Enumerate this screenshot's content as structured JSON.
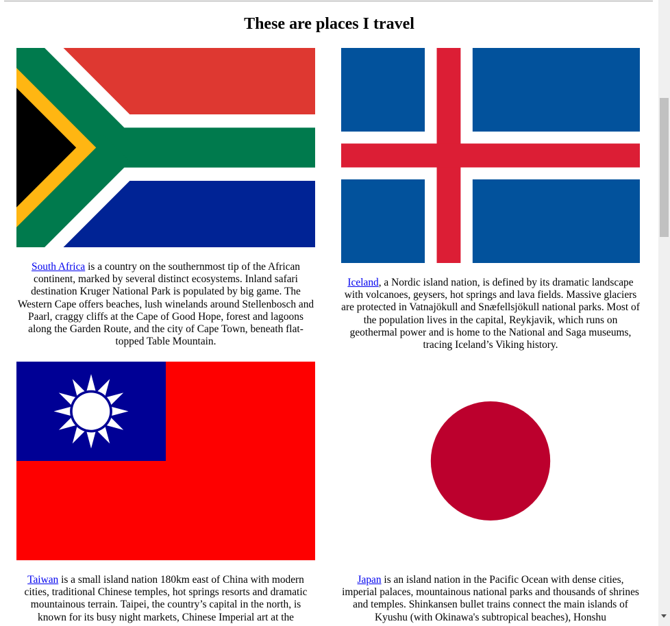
{
  "page": {
    "title": "These are places I travel"
  },
  "places": [
    {
      "link": "South Africa",
      "text": " is a country on the southernmost tip of the African continent, marked by several distinct ecosystems. Inland safari destination Kruger National Park is populated by big game. The Western Cape offers beaches, lush winelands around Stellenbosch and Paarl, craggy cliffs at the Cape of Good Hope, forest and lagoons along the Garden Route, and the city of Cape Town, beneath flat-topped Table Mountain."
    },
    {
      "link": "Iceland",
      "text": ", a Nordic island nation, is defined by its dramatic landscape with volcanoes, geysers, hot springs and lava fields. Massive glaciers are protected in Vatnajökull and Snæfellsjökull national parks. Most of the population lives in the capital, Reykjavik, which runs on geothermal power and is home to the National and Saga museums, tracing Iceland’s Viking history."
    },
    {
      "link": "Taiwan",
      "text": " is a small island nation 180km east of China with modern cities, traditional Chinese temples, hot springs resorts and dramatic mountainous terrain. Taipei, the country’s capital in the north, is known for its busy night markets, Chinese Imperial art at the"
    },
    {
      "link": "Japan",
      "text": " is an island nation in the Pacific Ocean with dense cities, imperial palaces, mountainous national parks and thousands of shrines and temples. Shinkansen bullet trains connect the main islands of Kyushu (with Okinawa's subtropical beaches), Honshu"
    }
  ],
  "flags": {
    "south_africa": {
      "red": "#de3831",
      "blue": "#002395",
      "green": "#007a4d",
      "gold": "#ffb612",
      "black": "#000000",
      "white": "#ffffff"
    },
    "iceland": {
      "blue": "#02529c",
      "red": "#dc1e35",
      "white": "#ffffff"
    },
    "taiwan": {
      "red": "#fe0000",
      "blue": "#000095",
      "white": "#ffffff"
    },
    "japan": {
      "red": "#bc002d",
      "white": "#ffffff"
    }
  }
}
